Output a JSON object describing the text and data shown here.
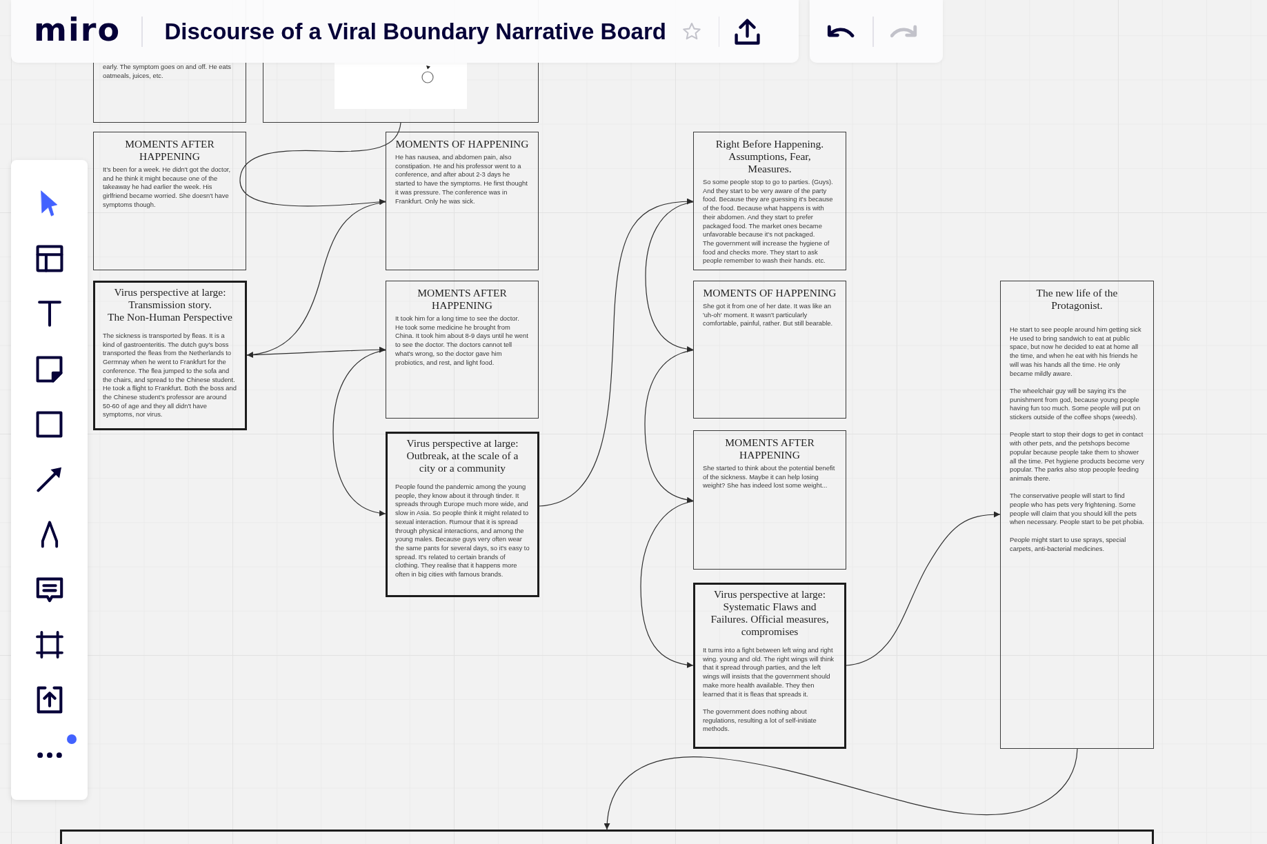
{
  "header": {
    "logo": "miro",
    "board_title": "Discourse of a Viral Boundary Narrative Board",
    "starred": false
  },
  "history": [
    {
      "kind": "undo",
      "disabled": false
    },
    {
      "kind": "redo",
      "disabled": true
    }
  ],
  "toolbar": {
    "tools": [
      {
        "kind": "select",
        "selected": true
      },
      {
        "kind": "templates",
        "selected": false
      },
      {
        "kind": "text",
        "selected": false
      },
      {
        "kind": "sticky",
        "selected": false
      },
      {
        "kind": "shape",
        "selected": false
      },
      {
        "kind": "line",
        "selected": false
      },
      {
        "kind": "pen",
        "selected": false
      },
      {
        "kind": "comment",
        "selected": false
      },
      {
        "kind": "frame",
        "selected": false
      },
      {
        "kind": "upload",
        "selected": false
      },
      {
        "kind": "more",
        "selected": false,
        "notification": true
      }
    ]
  },
  "board": {
    "cards": [
      {
        "kind": "regular",
        "paragraphs": [
          "early. The symptom goes on and off. He eats oatmeals, juices, etc."
        ]
      },
      {
        "kind": "embed"
      },
      {
        "kind": "regular",
        "title": "MOMENTS AFTER\nHAPPENING",
        "paragraphs": [
          "It’s been for a week. He didn't got the doctor, and he think it might because one of the takeaway he had earlier the week. His girlfriend became worried. She doesn't have symptoms though."
        ]
      },
      {
        "kind": "regular",
        "title": "MOMENTS OF HAPPENING",
        "paragraphs": [
          "He has nausea, and abdomen pain, also constipation. He and his professor went to a conference, and after about 2-3 days he started to have the symptoms. He first thought it was pressure. The conference was in Frankfurt. Only he was sick."
        ]
      },
      {
        "kind": "regular",
        "title": "Right Before Happening.\nAssumptions, Fear,\nMeasures.",
        "paragraphs": [
          "So some people stop to go to parties. (Guys). And they start to be very aware of the party food. Because they are guessing it's because of the food. Because what happens is with their abdomen. And they start to prefer packaged food. The market ones became unfavorable because it's not packaged.\nThe government will increase the hygiene of food and checks more. They start to ask people remember to wash their hands. etc."
        ]
      },
      {
        "kind": "bold",
        "title": "Virus perspective at large:\nTransmission story.\nThe Non-Human Perspective",
        "paragraphs": [
          "The sickness is transported by fleas. It is a kind of gastroenteritis. The dutch guy's boss transported the fleas from the Netherlands to Germnay when he went to Frankfurt for the conference. The flea jumped to the sofa and the chairs, and spread to the Chinese student. He took a flight to Frankfurt. Both the boss and the Chinese student's professor are around 50-60 of age and they all didn't have symptoms, nor virus."
        ]
      },
      {
        "kind": "regular",
        "title": "MOMENTS AFTER\nHAPPENING",
        "paragraphs": [
          "It took him for a long time to see the doctor. He took some medicine he brought from China. It took him about 8-9 days until he went to see the doctor. The doctors cannot tell what's wrong, so the doctor gave him probiotics, and rest, and light food."
        ]
      },
      {
        "kind": "regular",
        "title": "MOMENTS OF HAPPENING",
        "paragraphs": [
          "She got it from one of her date. It was like an 'uh-oh' moment. It wasn't particularly comfortable, painful, rather. But still bearable."
        ]
      },
      {
        "kind": "regular",
        "title": "The new life of the\nProtagonist.",
        "paragraphs": [
          "He start to see people around him getting sick\nHe used to bring sandwich to eat at public space, but now he decided to eat at home all the time, and when he eat with his friends he will was his hands all the time. He only became mildly aware.",
          "The wheelchair guy will be saying it's the punishment from god, because young people having fun too much. Some people will put on stickers outside of the coffee shops (weeds).",
          "People start to stop their dogs to get in contact with other pets, and the petshops become popular because people take them to shower all the time. Pet hygiene products become very popular. The parks also stop peoople feeding animals there.",
          "The conservative people will start to find people who has pets very frightening. Some people will claim that you should kill the pets when necessary. People start to be pet phobia.",
          "People might start to use sprays, special carpets, anti-bacterial medicines."
        ]
      },
      {
        "kind": "bold",
        "title": "Virus perspective at large:\nOutbreak, at the scale of a\ncity or a community",
        "paragraphs": [
          "People found the pandemic among the young people, they know about it through tinder. It spreads through Europe much more wide, and slow in Asia. So people think it might related to sexual interaction. Rumour that it is spread through physical interactions, and among the young males. Because guys very often wear the same pants for several days, so it's easy to spread. It's related to certain brands of clothing. They realise that it happens more often in big cities with famous brands."
        ]
      },
      {
        "kind": "regular",
        "title": "MOMENTS AFTER\nHAPPENING",
        "paragraphs": [
          "She started to think about the potential benefit of the sickness. Maybe it can help losing weight? She has indeed lost some weight..."
        ]
      },
      {
        "kind": "bold",
        "title": "Virus perspective at large:\nSystematic Flaws and\nFailures. Official measures,\ncompromises",
        "paragraphs": [
          "It turns into a fight between left wing and right wing. young and old. The right wings will think that it spread through parties, and the left wings will insists that the government should make more health available. They then learned that it is fleas that spreads it.",
          "The government does nothing about regulations, resulting a lot of self-initiate methods."
        ]
      },
      {
        "kind": "bold"
      }
    ]
  }
}
